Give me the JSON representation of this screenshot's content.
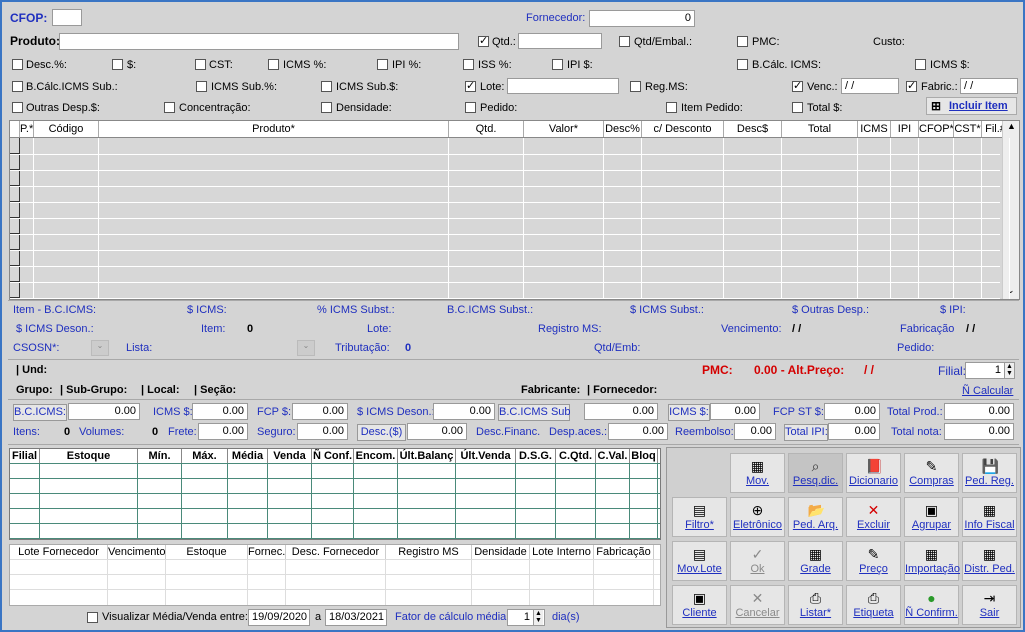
{
  "header": {
    "cfop_label": "CFOP:",
    "cfop_value": "",
    "fornecedor_label": "Fornecedor:",
    "fornecedor_value": "0",
    "produto_label": "Produto:",
    "produto_value": ""
  },
  "options_row1": {
    "qtd": "Qtd.:",
    "qtd_embal": "Qtd/Embal.:",
    "pmc": "PMC:",
    "custo": "Custo:"
  },
  "options_row2": {
    "desc_pct": "Desc.%:",
    "dollar": "$:",
    "cst": "CST:",
    "icms_pct": "ICMS %:",
    "ipi_pct": "IPI %:",
    "iss_pct": "ISS %:",
    "ipi_dollar": "IPI $:",
    "bc_icms": "B.Cálc. ICMS:",
    "icms_dollar": "ICMS $:"
  },
  "options_row3": {
    "bc_icms_sub": "B.Cálc.ICMS Sub.:",
    "icms_sub_pct": "ICMS Sub.%:",
    "icms_sub_dollar": "ICMS Sub.$:",
    "lote": "Lote:",
    "reg_ms": "Reg.MS:",
    "venc": "Venc.:",
    "venc_value": "/ /",
    "fabric": "Fabric.:",
    "fabric_value": "/ /"
  },
  "options_row4": {
    "outras": "Outras Desp.$:",
    "concentracao": "Concentração:",
    "densidade": "Densidade:",
    "pedido": "Pedido:",
    "item_pedido": "Item Pedido:",
    "total": "Total $:",
    "incluir_item": "Incluir Item"
  },
  "grid_columns": [
    "P.*",
    "Código",
    "Produto*",
    "Qtd.",
    "Valor*",
    "Desc%",
    "c/ Desconto",
    "Desc$",
    "Total",
    "ICMS",
    "IPI",
    "CFOP*",
    "CST*",
    "Fil.#"
  ],
  "item_info": {
    "row1": [
      "Item - B.C.ICMS:",
      "$ ICMS:",
      "% ICMS Subst.:",
      "B.C.ICMS Subst.:",
      "$ ICMS Subst.:",
      "$ Outras Desp.:",
      "$ IPI:"
    ],
    "icms_deson": "$ ICMS Deson.:",
    "item": "Item:",
    "item_value": "0",
    "lote": "Lote:",
    "registro_ms": "Registro MS:",
    "vencimento": "Vencimento:",
    "vencimento_value": "/ /",
    "fabricacao": "Fabricação",
    "fabricacao_value": "/ /",
    "csosn": "CSOSN*:",
    "lista": "Lista:",
    "tributacao": "Tributação:",
    "tributacao_value": "0",
    "qtd_emb": "Qtd/Emb:",
    "pedido": "Pedido:"
  },
  "status": {
    "und": "| Und:",
    "pmc": "PMC:",
    "pmc_value": "0.00 - Alt.Preço:",
    "alt_preco_value": "/ /",
    "filial_label": "Filial:",
    "filial_value": "1",
    "grupo": "Grupo:",
    "sub_grupo": "| Sub-Grupo:",
    "local": "| Local:",
    "secao": "| Seção:",
    "fabricante": "Fabricante:",
    "fornecedor": "| Fornecedor:",
    "n_calcular": "Ñ Calcular"
  },
  "totals_row1": {
    "bc_icms": "B.C.ICMS:",
    "bc_icms_v": "0.00",
    "icms": "ICMS $:",
    "icms_v": "0.00",
    "fcp": "FCP $:",
    "fcp_v": "0.00",
    "icms_deson": "$ ICMS Deson.:",
    "icms_deson_v": "0.00",
    "bc_icms_sub": "B.C.ICMS Sub",
    "bc_icms_sub_v": "0.00",
    "icms2": "ICMS $:",
    "icms2_v": "0.00",
    "fcp_st": "FCP ST $:",
    "fcp_st_v": "0.00",
    "total_prod": "Total Prod.:",
    "total_prod_v": "0.00"
  },
  "totals_row2": {
    "itens": "Itens:",
    "itens_v": "0",
    "volumes": "Volumes:",
    "volumes_v": "0",
    "frete": "Frete:",
    "frete_v": "0.00",
    "seguro": "Seguro:",
    "seguro_v": "0.00",
    "desc": "Desc.($)",
    "desc_v": "0.00",
    "desc_financ": "Desc.Financ.",
    "desp_aces": "Desp.aces.:",
    "desp_aces_v": "0.00",
    "reembolso": "Reembolso:",
    "reembolso_v": "0.00",
    "total_ipi": "Total IPI:",
    "total_ipi_v": "0.00",
    "total_nota": "Total nota:",
    "total_nota_v": "0.00"
  },
  "stock_columns": [
    "Filial",
    "Estoque",
    "Mín.",
    "Máx.",
    "Média",
    "Venda",
    "Ñ Conf.",
    "Encom.",
    "Últ.Balanç",
    "Últ.Venda",
    "D.S.G.",
    "C.Qtd.",
    "C.Val.",
    "Bloq"
  ],
  "lote_columns": [
    "Lote Fornecedor",
    "Vencimento",
    "Estoque",
    "Fornec.",
    "Desc. Fornecedor",
    "Registro MS",
    "Densidade",
    "Lote Interno",
    "Fabricação"
  ],
  "footer": {
    "visualizar": "Visualizar Média/Venda entre:",
    "date_from": "19/09/2020",
    "a": "a",
    "date_to": "18/03/2021",
    "fator": "Fator de cálculo média:",
    "fator_value": "1",
    "dias": "dia(s)"
  },
  "buttons": [
    [
      "Mov.",
      "Pesq.dic.",
      "Dicionario",
      "Compras",
      "Ped. Reg."
    ],
    [
      "Filtro*",
      "Eletrônico",
      "Ped. Arq.",
      "Excluir",
      "Agrupar",
      "Info Fiscal"
    ],
    [
      "Mov.Lote",
      "Ok",
      "Grade",
      "Preço",
      "Importação",
      "Distr. Ped."
    ],
    [
      "Cliente",
      "Cancelar",
      "Listar*",
      "Etiqueta",
      "Ñ Confirm.",
      "Sair"
    ]
  ]
}
